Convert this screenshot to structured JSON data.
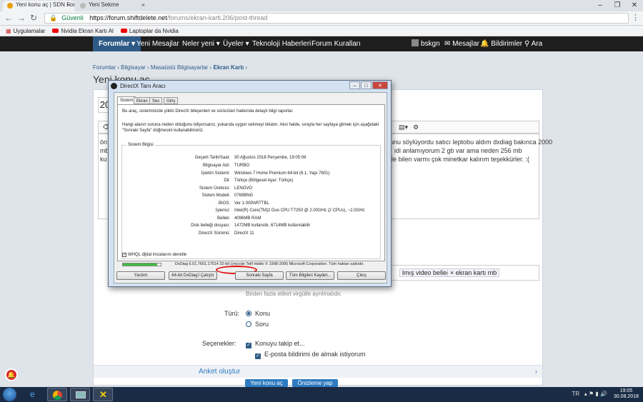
{
  "browser": {
    "tabs": [
      {
        "label": "Yeni konu aç | SDN Forum"
      },
      {
        "label": "Yeni Sekme"
      }
    ],
    "address": {
      "security": "Güvenli",
      "host": "https://forum.shiftdelete.net",
      "path": "/forums/ekran-karti.206/post-thread"
    },
    "bookmarks": [
      {
        "label": "Uygulamalar"
      },
      {
        "label": "Nvidia Ekran Kartı Al"
      },
      {
        "label": "Laptoplar da Nvidia"
      }
    ]
  },
  "forum_nav": {
    "items": [
      "Forumlar",
      "Yeni Mesajlar",
      "Neler yeni",
      "Üyeler",
      "Teknoloji Haberleri",
      "Forum Kuralları"
    ],
    "user": "bskgn",
    "messages": "Mesajlar",
    "alerts": "Bildirimler",
    "search": "Ara"
  },
  "breadcrumb": [
    "Forumlar",
    "Bilgisayar",
    "Masaüstü Bilgisayarlar",
    "Ekran Kartı"
  ],
  "page_title": "Yeni konu aç",
  "post_snippets": [
    "unu söylüyordu satıcı leptobu aldım dxdiag bakınca 2000",
    "idi anlamıyorum 2 gb var ama neden 256 mb",
    "le bilen varmı çok minetkar kalırım teşekkürler. :("
  ],
  "tags": [
    "lmış video bellegi",
    "ekran kartı mb"
  ],
  "tags_hint": "Birden fazla etiket virgülle ayrılmalıdır.",
  "form": {
    "type_label": "Türü:",
    "type_options": [
      {
        "label": "Konu",
        "selected": true
      },
      {
        "label": "Soru",
        "selected": false
      }
    ],
    "options_label": "Seçenekler:",
    "options": [
      {
        "label": "Konuyu takip et...",
        "checked": true
      },
      {
        "label": "E-posta bildirimi de almak istiyorum",
        "checked": true
      }
    ],
    "poll": "Anket oluştur",
    "submit": "Yeni konu aç",
    "preview": "Önizleme yap"
  },
  "dxdiag": {
    "title": "DirectX Tanı Aracı",
    "tabs": [
      "Sistem",
      "Ekran",
      "Ses",
      "Giriş"
    ],
    "intro1": "Bu araç, sisteminizde yüklü DirectX bileşenleri ve sürücüleri hakkında detaylı bilgi raporlar.",
    "intro2": "Hangi alanın soruna neden olduğunu biliyorsanız, yukarıda uygun sekmeyi tıklatın.  Aksi halde, sırayla her sayfaya gitmek için aşağıdaki",
    "intro3": "\"Sonraki Sayfa\" düğmesini kullanabilirsiniz.",
    "group_title": "Sistem Bilgisi",
    "rows": [
      {
        "label": "Geçerli Tarih/Saat:",
        "value": "30 Ağustos 2018 Perşembe, 19:05:08"
      },
      {
        "label": "Bilgisayar Adı:",
        "value": "TURBO"
      },
      {
        "label": "İşletim Sistemi:",
        "value": "Windows 7 Home Premium 64-bit (6.1, Yapı 7601)"
      },
      {
        "label": "Dil:",
        "value": "Türkçe (Bölgesel Ayar: Türkçe)"
      },
      {
        "label": "Sistem Üreticisi:",
        "value": "LENOVO"
      },
      {
        "label": "Sistem Modeli:",
        "value": "0769BNG"
      },
      {
        "label": "BIOS:",
        "value": "Ver 1.00PARTTBL"
      },
      {
        "label": "İşlemci:",
        "value": "Intel(R) Core(TM)2 Duo CPU    T7250  @ 2.00GHz (2 CPUs), ~2.0GHz"
      },
      {
        "label": "Bellek:",
        "value": "4096MB RAM"
      },
      {
        "label": "Disk belleği dosyası:",
        "value": "1472MB kullanıldı, 6714MB kullanılabilir"
      },
      {
        "label": "DirectX Sürümü:",
        "value": "DirectX 11"
      }
    ],
    "whql": "WHQL dijital imzalarını denetle",
    "version": "DxDiag 6.01.7601.17514 32-bit Unicode  Telif Hakkı © 1998-2006 Microsoft Corporation.  Tüm hakları saklıdır.",
    "progress": 0.9,
    "buttons": [
      "Yardım",
      "64-bit DxDiag'i Çalıştır",
      "Sonraki Sayfa",
      "Tüm Bilgileri Kaydet...",
      "Çıkış"
    ]
  },
  "taskbar": {
    "lang": "TR",
    "time": "19:05",
    "date": "30.08.2018"
  }
}
